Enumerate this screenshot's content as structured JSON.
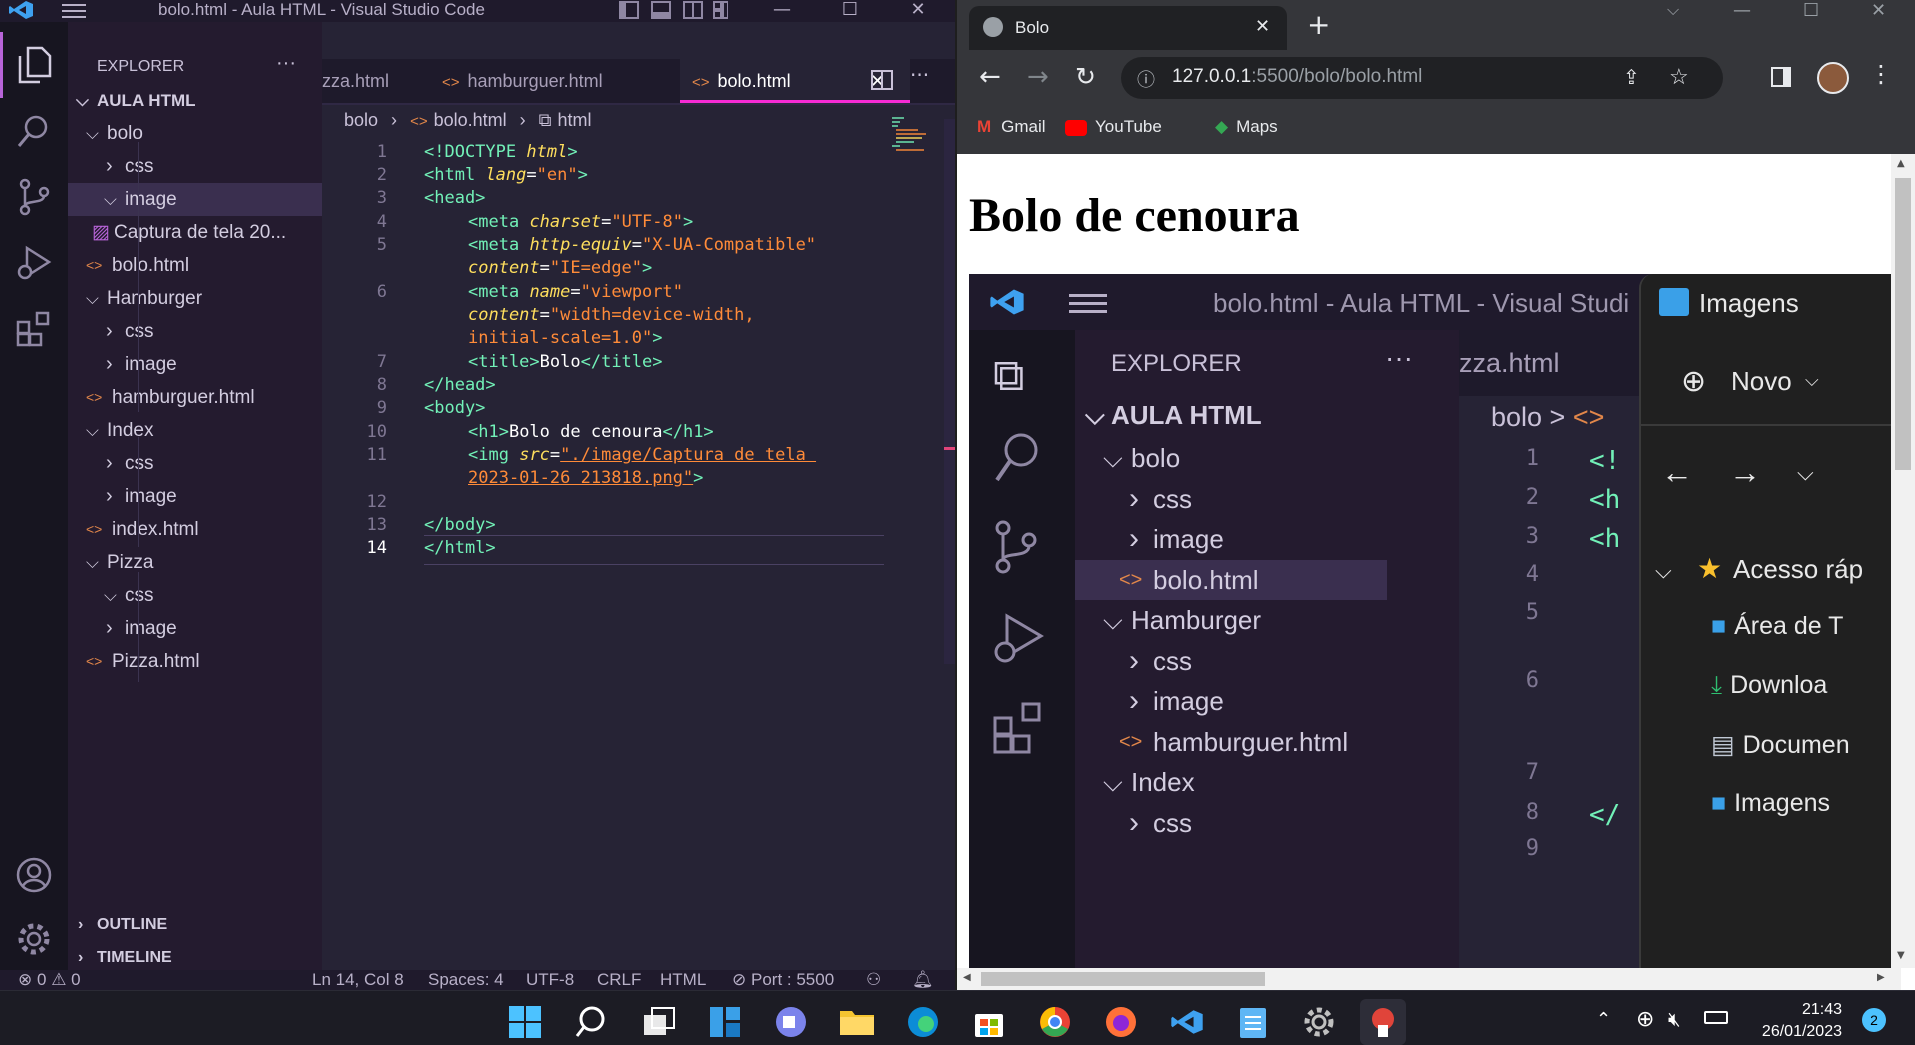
{
  "vscode": {
    "window_title": "bolo.html - Aula HTML - Visual Studio Code",
    "explorer_label": "EXPLORER",
    "more_label": "···",
    "workspace": "AULA HTML",
    "tree": [
      {
        "label": "bolo",
        "kind": "folder-open",
        "depth": 1
      },
      {
        "label": "css",
        "kind": "folder-closed",
        "depth": 2
      },
      {
        "label": "image",
        "kind": "folder-open",
        "depth": 2,
        "selected": true
      },
      {
        "label": "Captura de tela 20...",
        "kind": "image-file",
        "depth": 3
      },
      {
        "label": "bolo.html",
        "kind": "html-file",
        "depth": 2
      },
      {
        "label": "Hamburger",
        "kind": "folder-open",
        "depth": 1
      },
      {
        "label": "css",
        "kind": "folder-closed",
        "depth": 2
      },
      {
        "label": "image",
        "kind": "folder-closed",
        "depth": 2
      },
      {
        "label": "hamburguer.html",
        "kind": "html-file",
        "depth": 2
      },
      {
        "label": "Index",
        "kind": "folder-open",
        "depth": 1
      },
      {
        "label": "css",
        "kind": "folder-closed",
        "depth": 2
      },
      {
        "label": "image",
        "kind": "folder-closed",
        "depth": 2
      },
      {
        "label": "index.html",
        "kind": "html-file",
        "depth": 2
      },
      {
        "label": "Pizza",
        "kind": "folder-open",
        "depth": 1
      },
      {
        "label": "css",
        "kind": "folder-open",
        "depth": 2
      },
      {
        "label": "image",
        "kind": "folder-closed",
        "depth": 2
      },
      {
        "label": "Pizza.html",
        "kind": "html-file",
        "depth": 2
      }
    ],
    "outline_label": "OUTLINE",
    "timeline_label": "TIMELINE",
    "tabs": [
      {
        "label": "zza.html",
        "active": false
      },
      {
        "label": "hamburguer.html",
        "active": false
      },
      {
        "label": "bolo.html",
        "active": true
      }
    ],
    "breadcrumb": {
      "folder": "bolo",
      "file": "bolo.html",
      "symbol": "html"
    },
    "code_lines": [
      {
        "num": "1"
      },
      {
        "num": "2"
      },
      {
        "num": "3"
      },
      {
        "num": "4"
      },
      {
        "num": "5"
      },
      {
        "num": ""
      },
      {
        "num": "6"
      },
      {
        "num": ""
      },
      {
        "num": ""
      },
      {
        "num": "7"
      },
      {
        "num": "8"
      },
      {
        "num": "9"
      },
      {
        "num": "10"
      },
      {
        "num": "11"
      },
      {
        "num": ""
      },
      {
        "num": "12"
      },
      {
        "num": "13"
      },
      {
        "num": "14"
      }
    ],
    "code": {
      "l1a": "<!DOCTYPE",
      "l1b": "html",
      "l1c": ">",
      "l2a": "<html",
      "l2b": "lang",
      "l2c": "=",
      "l2d": "\"en\"",
      "l2e": ">",
      "l3": "<head>",
      "l4a": "<meta",
      "l4b": "charset",
      "l4c": "=",
      "l4d": "\"UTF-8\"",
      "l4e": ">",
      "l5a": "<meta",
      "l5b": "http-equiv",
      "l5c": "=",
      "l5d": "\"X-UA-Compatible\"",
      "l5f": "content",
      "l5g": "=",
      "l5h": "\"IE=edge\"",
      "l5i": ">",
      "l6a": "<meta",
      "l6b": "name",
      "l6c": "=",
      "l6d": "\"viewport\"",
      "l6f": "content",
      "l6g": "=",
      "l6h": "\"width=device-width,",
      "l6i": "initial-scale=1.0\"",
      "l6j": ">",
      "l7a": "<title>",
      "l7b": "Bolo",
      "l7c": "</title>",
      "l8": "</head>",
      "l9": "<body>",
      "l10a": "<h1>",
      "l10b": "Bolo de cenoura",
      "l10c": "</h1>",
      "l11a": "<img",
      "l11b": "src",
      "l11c": "=",
      "l11d": "\"./image/Captura de tela ",
      "l11e": "2023-01-26 213818.png\"",
      "l11f": ">",
      "l13": "</body>",
      "l14": "</html>"
    },
    "status": {
      "errors": "0",
      "warnings": "0",
      "position": "Ln 14, Col 8",
      "spaces": "Spaces: 4",
      "encoding": "UTF-8",
      "eol": "CRLF",
      "language": "HTML",
      "port": "Port : 5500"
    }
  },
  "chrome": {
    "tab_title": "Bolo",
    "url_host": "127.0.0.1",
    "url_path": ":5500/bolo/bolo.html",
    "bookmarks": [
      "Gmail",
      "YouTube",
      "Maps"
    ],
    "page_heading": "Bolo de cenoura",
    "screenshot": {
      "title": "bolo.html - Aula HTML - Visual Studi",
      "explorer": "EXPLORER",
      "tab": "zza.html",
      "workspace": "AULA HTML",
      "breadcrumb": "bolo >",
      "tree": [
        "bolo",
        "css",
        "image",
        "bolo.html",
        "Hamburger",
        "css",
        "image",
        "hamburguer.html",
        "Index",
        "css"
      ],
      "lines": [
        "1",
        "2",
        "3",
        "4",
        "5",
        "6",
        "7",
        "8",
        "9"
      ],
      "explorer_window": {
        "title": "Imagens",
        "new_label": "Novo",
        "quick_access": "Acesso ráp",
        "items": [
          "Área de T",
          "Downloa",
          "Documen",
          "Imagens"
        ]
      }
    }
  },
  "taskbar": {
    "time": "21:43",
    "date": "26/01/2023",
    "notifications": "2"
  }
}
